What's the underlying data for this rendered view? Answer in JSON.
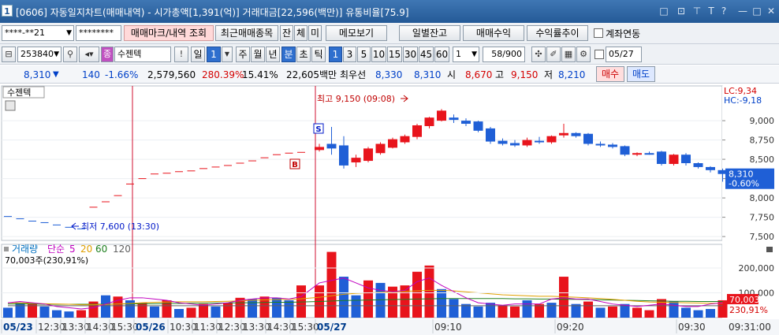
{
  "window": {
    "badge": "1",
    "title": "[0606] 자동일지차트(매매내역) - 시가총액[1,391(억)] 거래대금[22,596(백만)] 유통비율[75.9]",
    "controls": [
      "□",
      "⊡",
      "T",
      "?",
      "—",
      "□",
      "✕"
    ]
  },
  "toolbar1": {
    "account": "****-**21",
    "password": "********",
    "buttons": [
      "매매마크/내역 조회",
      "최근매매종목",
      "잔",
      "체",
      "미",
      "메모보기",
      "일별잔고",
      "매매수익",
      "수익률추이"
    ],
    "checkbox_label": "계좌연동"
  },
  "toolbar2": {
    "code": "253840",
    "stock_name": "수젠텍",
    "period_buttons": [
      "일",
      "주",
      "월",
      "년",
      "분",
      "초",
      "틱"
    ],
    "selected_period": "분",
    "interval_value": "1",
    "interval_buttons": [
      "1",
      "3",
      "5",
      "10",
      "15",
      "30",
      "45",
      "60"
    ],
    "selected_interval": "1",
    "count_value": "1",
    "range_value": "58",
    "range_total": "/900",
    "date_value": "05/27"
  },
  "quote": {
    "price": "8,310",
    "arrow": "▼",
    "change": "140",
    "change_pct": "-1.66%",
    "volume": "2,579,560",
    "volume_ratio": "280.39%",
    "turnover": "15.41%",
    "amount": "22,605백만",
    "best_label": "최우선",
    "ask": "8,330",
    "bid": "8,310",
    "open_label": "시",
    "open": "8,670",
    "high_label": "고",
    "high": "9,150",
    "low_label": "저",
    "low": "8,210",
    "buy_button": "매수",
    "sell_button": "매도"
  },
  "chart_data": {
    "type": "candlestick",
    "stock_label": "수젠텍",
    "price_axis": {
      "ticks": [
        "9,000",
        "8,750",
        "8,500",
        "8,250",
        "8,000",
        "7,750",
        "7,500"
      ],
      "range": [
        7450,
        9450
      ]
    },
    "lc_label": "LC:9,34",
    "hc_label": "HC:-9,18",
    "current_price_label": "8,310",
    "current_change_label": "-0.60%",
    "high_annotation": "최고 9,150 (09:08)",
    "low_annotation": "최저 7,600 (13:30)",
    "buy_marker": "B",
    "sell_marker": "S",
    "prior_sessions": {
      "close_levels": [
        7760,
        7730,
        7700,
        7680,
        7650,
        7620,
        7600,
        7880,
        7950,
        8030,
        8180,
        8250,
        8310,
        8320,
        8340,
        8350,
        8380,
        8400,
        8420,
        8450,
        8480,
        8520,
        8560,
        8580,
        8590
      ]
    },
    "candles": [
      {
        "o": 8620,
        "c": 8660,
        "h": 8700,
        "l": 8600
      },
      {
        "o": 8700,
        "c": 8640,
        "h": 8920,
        "l": 8560
      },
      {
        "o": 8680,
        "c": 8420,
        "h": 8800,
        "l": 8380
      },
      {
        "o": 8460,
        "c": 8520,
        "h": 8560,
        "l": 8400
      },
      {
        "o": 8480,
        "c": 8640,
        "h": 8660,
        "l": 8460
      },
      {
        "o": 8580,
        "c": 8700,
        "h": 8720,
        "l": 8560
      },
      {
        "o": 8650,
        "c": 8760,
        "h": 8780,
        "l": 8640
      },
      {
        "o": 8720,
        "c": 8800,
        "h": 8820,
        "l": 8700
      },
      {
        "o": 8790,
        "c": 8940,
        "h": 8960,
        "l": 8760
      },
      {
        "o": 8930,
        "c": 9040,
        "h": 9050,
        "l": 8900
      },
      {
        "o": 9000,
        "c": 9130,
        "h": 9150,
        "l": 8990
      },
      {
        "o": 9040,
        "c": 9010,
        "h": 9080,
        "l": 8970
      },
      {
        "o": 9000,
        "c": 8960,
        "h": 9030,
        "l": 8930
      },
      {
        "o": 8990,
        "c": 8870,
        "h": 9000,
        "l": 8850
      },
      {
        "o": 8900,
        "c": 8730,
        "h": 8920,
        "l": 8700
      },
      {
        "o": 8740,
        "c": 8700,
        "h": 8770,
        "l": 8680
      },
      {
        "o": 8710,
        "c": 8680,
        "h": 8750,
        "l": 8660
      },
      {
        "o": 8680,
        "c": 8750,
        "h": 8780,
        "l": 8660
      },
      {
        "o": 8740,
        "c": 8720,
        "h": 8790,
        "l": 8700
      },
      {
        "o": 8720,
        "c": 8800,
        "h": 8810,
        "l": 8700
      },
      {
        "o": 8810,
        "c": 8840,
        "h": 8960,
        "l": 8780
      },
      {
        "o": 8840,
        "c": 8800,
        "h": 8850,
        "l": 8780
      },
      {
        "o": 8830,
        "c": 8700,
        "h": 8840,
        "l": 8680
      },
      {
        "o": 8700,
        "c": 8690,
        "h": 8730,
        "l": 8660
      },
      {
        "o": 8690,
        "c": 8660,
        "h": 8710,
        "l": 8640
      },
      {
        "o": 8670,
        "c": 8560,
        "h": 8680,
        "l": 8540
      },
      {
        "o": 8560,
        "c": 8580,
        "h": 8590,
        "l": 8540
      },
      {
        "o": 8580,
        "c": 8570,
        "h": 8600,
        "l": 8560
      },
      {
        "o": 8600,
        "c": 8440,
        "h": 8610,
        "l": 8420
      },
      {
        "o": 8440,
        "c": 8560,
        "h": 8570,
        "l": 8420
      },
      {
        "o": 8560,
        "c": 8450,
        "h": 8580,
        "l": 8420
      },
      {
        "o": 8450,
        "c": 8400,
        "h": 8460,
        "l": 8380
      },
      {
        "o": 8400,
        "c": 8360,
        "h": 8410,
        "l": 8330
      },
      {
        "o": 8360,
        "c": 8310,
        "h": 8380,
        "l": 8210
      }
    ],
    "volume_panel": {
      "title": "거래량",
      "legend": [
        "단순",
        "5",
        "20",
        "60",
        "120"
      ],
      "value_label": "70,003주(230,91%)",
      "axis_ticks": [
        "200,000",
        "100,000"
      ],
      "range": [
        0,
        270000
      ],
      "current_label": "70,003",
      "current_pct_label": "230,91%",
      "prior_volumes": [
        {
          "v": 40000,
          "up": false
        },
        {
          "v": 60000,
          "up": false
        },
        {
          "v": 55000,
          "up": true
        },
        {
          "v": 45000,
          "up": false
        },
        {
          "v": 30000,
          "up": false
        },
        {
          "v": 25000,
          "up": false
        },
        {
          "v": 30000,
          "up": true
        },
        {
          "v": 65000,
          "up": true
        },
        {
          "v": 90000,
          "up": false
        },
        {
          "v": 85000,
          "up": true
        },
        {
          "v": 70000,
          "up": false
        },
        {
          "v": 60000,
          "up": true
        },
        {
          "v": 45000,
          "up": false
        },
        {
          "v": 70000,
          "up": true
        },
        {
          "v": 35000,
          "up": false
        },
        {
          "v": 40000,
          "up": true
        },
        {
          "v": 55000,
          "up": true
        },
        {
          "v": 45000,
          "up": false
        },
        {
          "v": 60000,
          "up": true
        },
        {
          "v": 80000,
          "up": true
        },
        {
          "v": 75000,
          "up": false
        },
        {
          "v": 85000,
          "up": true
        },
        {
          "v": 80000,
          "up": false
        },
        {
          "v": 70000,
          "up": false
        },
        {
          "v": 130000,
          "up": true
        }
      ],
      "candle_volumes": [
        {
          "v": 130000,
          "up": true
        },
        {
          "v": 265000,
          "up": true
        },
        {
          "v": 165000,
          "up": false
        },
        {
          "v": 90000,
          "up": false
        },
        {
          "v": 150000,
          "up": true
        },
        {
          "v": 140000,
          "up": false
        },
        {
          "v": 125000,
          "up": true
        },
        {
          "v": 130000,
          "up": true
        },
        {
          "v": 185000,
          "up": true
        },
        {
          "v": 210000,
          "up": true
        },
        {
          "v": 115000,
          "up": false
        },
        {
          "v": 75000,
          "up": false
        },
        {
          "v": 55000,
          "up": false
        },
        {
          "v": 45000,
          "up": false
        },
        {
          "v": 60000,
          "up": false
        },
        {
          "v": 50000,
          "up": true
        },
        {
          "v": 45000,
          "up": true
        },
        {
          "v": 70000,
          "up": false
        },
        {
          "v": 55000,
          "up": true
        },
        {
          "v": 60000,
          "up": false
        },
        {
          "v": 165000,
          "up": true
        },
        {
          "v": 55000,
          "up": false
        },
        {
          "v": 65000,
          "up": true
        },
        {
          "v": 40000,
          "up": false
        },
        {
          "v": 45000,
          "up": true
        },
        {
          "v": 55000,
          "up": false
        },
        {
          "v": 40000,
          "up": true
        },
        {
          "v": 30000,
          "up": true
        },
        {
          "v": 75000,
          "up": true
        },
        {
          "v": 65000,
          "up": false
        },
        {
          "v": 40000,
          "up": false
        },
        {
          "v": 30000,
          "up": false
        },
        {
          "v": 35000,
          "up": false
        },
        {
          "v": 70003,
          "up": true
        }
      ],
      "ma5": [
        60000,
        65000,
        60000,
        55000,
        45000,
        40000,
        35000,
        40000,
        55000,
        70000,
        80000,
        80000,
        75000,
        70000,
        60000,
        55000,
        50000,
        55000,
        60000,
        70000,
        75000,
        80000,
        80000,
        75000,
        85000,
        140000,
        150000,
        160000,
        140000,
        120000,
        110000,
        105000,
        110000,
        145000,
        160000,
        130000,
        105000,
        80000,
        60000,
        55000,
        50000,
        55000,
        55000,
        55000,
        75000,
        80000,
        75000,
        75000,
        65000,
        55000,
        50000,
        45000,
        50000,
        55000,
        50000,
        45000,
        45000,
        55000,
        60000
      ],
      "ma20": [
        60000,
        60000,
        58000,
        56000,
        55000,
        54000,
        52000,
        52000,
        53000,
        55000,
        57000,
        60000,
        62000,
        63000,
        64000,
        64000,
        64000,
        65000,
        66000,
        68000,
        70000,
        72000,
        73000,
        74000,
        76000,
        82000,
        88000,
        94000,
        98000,
        100000,
        102000,
        104000,
        106000,
        108000,
        110000,
        110000,
        108000,
        104000,
        100000,
        96000,
        92000,
        90000,
        88000,
        86000,
        86000,
        84000,
        82000,
        80000,
        77000,
        74000,
        70000,
        66000,
        63000,
        62000,
        61000,
        60000,
        59000,
        58000,
        58000
      ],
      "ma60": [
        55000,
        55000,
        55000,
        54000,
        54000,
        54000,
        54000,
        54000,
        54000,
        55000,
        55000,
        56000,
        56000,
        57000,
        57000,
        58000,
        58000,
        59000,
        59000,
        60000,
        60000,
        61000,
        62000,
        62000,
        63000,
        65000,
        67000,
        69000,
        70000,
        71000,
        72000,
        73000,
        74000,
        75000,
        76000,
        77000,
        77000,
        77000,
        77000,
        77000,
        77000,
        76000,
        76000,
        75000,
        75000,
        74000,
        74000,
        73000,
        72000,
        71000,
        70000,
        69000,
        68000,
        67000,
        66000,
        66000,
        65000,
        65000,
        65000
      ],
      "ma120": [
        48000,
        48000,
        48000,
        48000,
        48000,
        48000,
        48000,
        48000,
        48000,
        48000,
        48000,
        48000,
        48000,
        48000,
        48000,
        48000,
        48000,
        48000,
        48000,
        48000,
        48000,
        48000,
        48000,
        48000,
        48000,
        48000,
        48000,
        48000,
        48000,
        48000,
        48000,
        48000,
        48000,
        48000,
        48000,
        48000,
        48000,
        48000,
        48000,
        48000,
        48000,
        48000,
        48000,
        48000,
        48000,
        48000,
        48000,
        48000,
        48000,
        48000,
        48000,
        48000,
        48000,
        48000,
        48000,
        48000,
        48000,
        48000,
        48000
      ]
    },
    "time_axis": {
      "labels": [
        "05/23",
        "12:30",
        "13:30",
        "14:30",
        "15:30",
        "05/26",
        "10:30",
        "11:30",
        "12:30",
        "13:30",
        "14:30",
        "15:30",
        "05/27",
        "09:10",
        "09:20",
        "09:30"
      ],
      "bold": [
        "05/23",
        "05/26",
        "05/27"
      ],
      "right_label": "09:31:00"
    },
    "colors": {
      "up": "#e8141c",
      "down": "#1f5fd6",
      "ma5": "#c000c0",
      "ma20": "#e0a000",
      "ma60": "#208020",
      "ma120": "#606060"
    }
  }
}
